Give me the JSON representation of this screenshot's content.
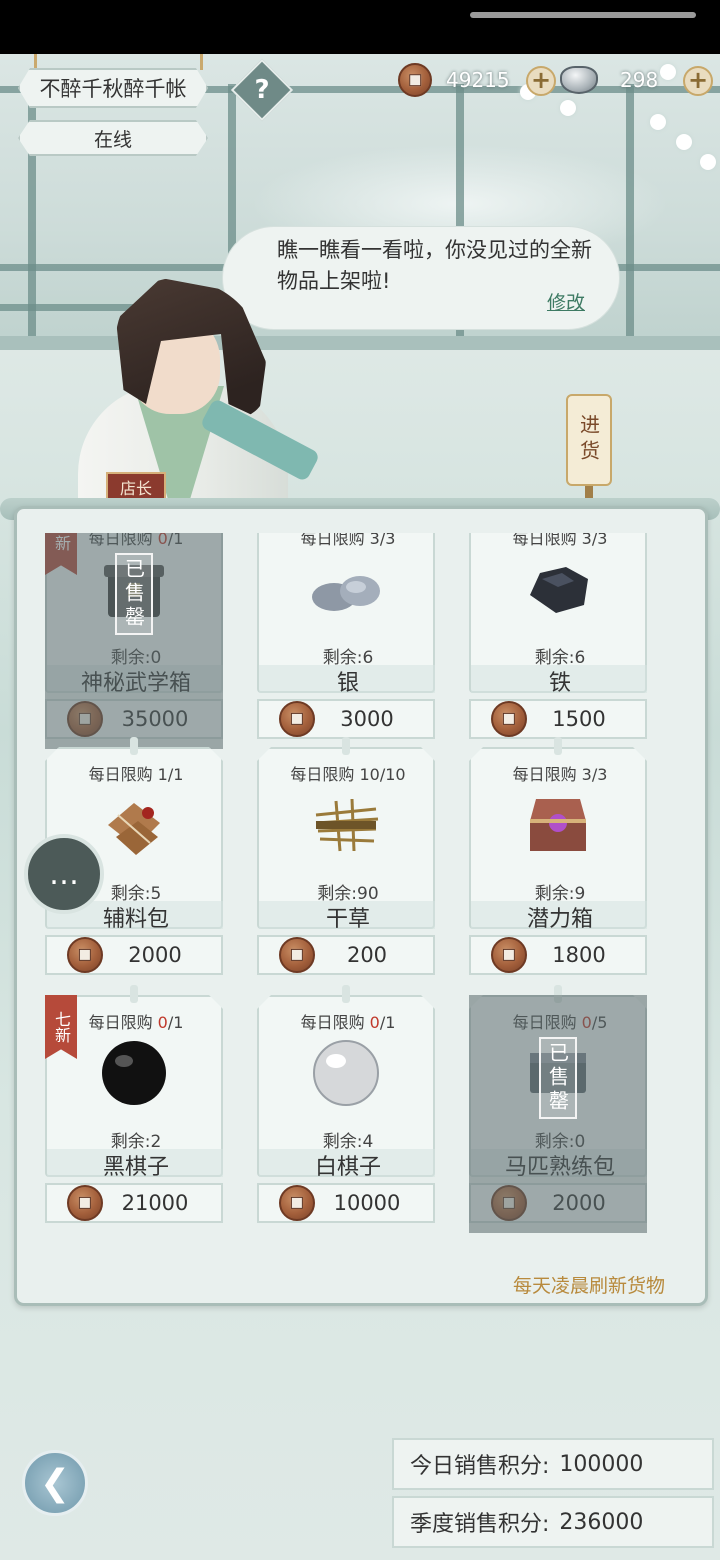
{
  "header": {
    "shop_name": "不醉千秋醉千帐",
    "status": "在线",
    "help_symbol": "?"
  },
  "currency": {
    "copper": "49215",
    "silver": "298",
    "add_symbol": "+"
  },
  "dialogue": {
    "text": "瞧一瞧看一看啦，你没见过的全新物品上架啦!",
    "edit_label": "修改"
  },
  "keeper": {
    "badge": "店长"
  },
  "stock_button": {
    "label": "进货"
  },
  "shop": {
    "items": [
      {
        "limit_label": "每日限购",
        "limit_bought": "0",
        "limit_total": "/1",
        "remain": "剩余:0",
        "name": "神秘武学箱",
        "price": "35000",
        "sold_out": true,
        "sold_label": "已售罄",
        "new_tag": "新",
        "icon": "mystery-chest-icon"
      },
      {
        "limit_label": "每日限购",
        "limit_bought": "3",
        "limit_total": "/3",
        "remain": "剩余:6",
        "name": "银",
        "price": "3000",
        "sold_out": false,
        "icon": "silver-ore-icon"
      },
      {
        "limit_label": "每日限购",
        "limit_bought": "3",
        "limit_total": "/3",
        "remain": "剩余:6",
        "name": "铁",
        "price": "1500",
        "sold_out": false,
        "icon": "iron-ore-icon"
      },
      {
        "limit_label": "每日限购",
        "limit_bought": "1",
        "limit_total": "/1",
        "remain": "剩余:5",
        "name": "辅料包",
        "price": "2000",
        "sold_out": false,
        "icon": "material-pack-icon"
      },
      {
        "limit_label": "每日限购",
        "limit_bought": "10",
        "limit_total": "/10",
        "remain": "剩余:90",
        "name": "干草",
        "price": "200",
        "sold_out": false,
        "icon": "hay-icon"
      },
      {
        "limit_label": "每日限购",
        "limit_bought": "3",
        "limit_total": "/3",
        "remain": "剩余:9",
        "name": "潜力箱",
        "price": "1800",
        "sold_out": false,
        "icon": "potential-chest-icon"
      },
      {
        "limit_label": "每日限购",
        "limit_bought": "0",
        "limit_total": "/1",
        "remain": "剩余:2",
        "name": "黑棋子",
        "price": "21000",
        "sold_out": false,
        "new_tag": "七新",
        "icon": "black-go-stone-icon"
      },
      {
        "limit_label": "每日限购",
        "limit_bought": "0",
        "limit_total": "/1",
        "remain": "剩余:4",
        "name": "白棋子",
        "price": "10000",
        "sold_out": false,
        "icon": "white-go-stone-icon"
      },
      {
        "limit_label": "每日限购",
        "limit_bought": "0",
        "limit_total": "/5",
        "remain": "剩余:0",
        "name": "马匹熟练包",
        "price": "2000",
        "sold_out": true,
        "sold_label": "已售罄",
        "icon": "horse-skill-pack-icon"
      }
    ],
    "refresh_note": "每天凌晨刷新货物"
  },
  "scores": {
    "today_label": "今日销售积分:",
    "today_value": "100000",
    "season_label": "季度销售积分:",
    "season_value": "236000"
  },
  "colors": {
    "limit_zero": "#c0392b",
    "refresh_note": "#b88a3d",
    "edit_link": "#3d7a63"
  }
}
